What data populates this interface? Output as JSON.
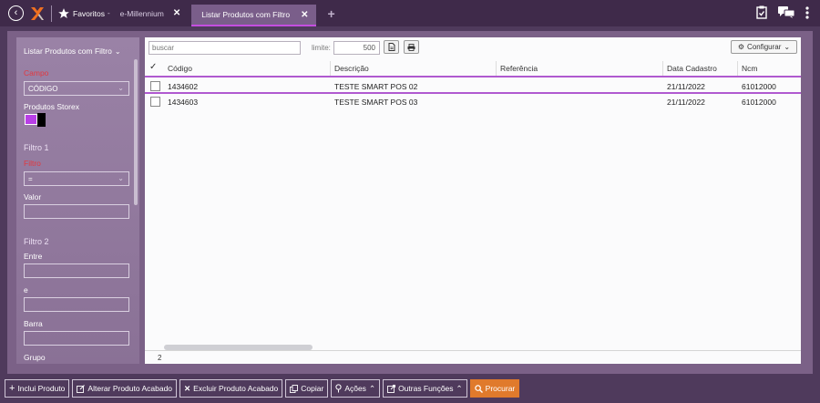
{
  "topbar": {
    "favorites_label": "Favoritos",
    "favorites_arrow": "-",
    "tabs": [
      {
        "label": "e-Millennium",
        "close": "✕"
      },
      {
        "label": "Listar Produtos com Filtro",
        "close": "✕",
        "active": true
      }
    ],
    "add_tab": "+",
    "icons": [
      "back-icon",
      "logo-icon",
      "star-icon",
      "clipboard-check-icon",
      "chat-icon",
      "kebab-menu-icon"
    ]
  },
  "sidebar": {
    "title": "Listar Produtos com Filtro",
    "title_chevron": "⌄",
    "campo_label": "Campo",
    "campo_value": "CÓDIGO",
    "produtos_storex_label": "Produtos Storex",
    "swatch_colors": [
      "#b83fe6",
      "#000000"
    ],
    "filtro1_heading": "Filtro 1",
    "filtro_label": "Filtro",
    "filtro_value": "=",
    "valor_label": "Valor",
    "valor_value": "",
    "filtro2_heading": "Filtro 2",
    "entre_label": "Entre",
    "e_label": "e",
    "barra_label": "Barra",
    "grupo_label": "Grupo"
  },
  "main": {
    "search_placeholder": "buscar",
    "limit_label": "limite:",
    "limit_value": "500",
    "configure_label": "Configurar",
    "columns": [
      "Código",
      "Descrição",
      "Referência",
      "Data Cadastro",
      "Ncm"
    ],
    "rows": [
      {
        "codigo": "1434602",
        "descricao": "TESTE SMART POS 02",
        "referencia": "",
        "data": "21/11/2022",
        "ncm": "61012000"
      },
      {
        "codigo": "1434603",
        "descricao": "TESTE SMART POS 03",
        "referencia": "",
        "data": "21/11/2022",
        "ncm": "61012000"
      }
    ],
    "count": "2"
  },
  "toolbar": {
    "buttons": [
      {
        "icon": "+",
        "label": "Inclui Produto"
      },
      {
        "icon": "edit-icon",
        "label": "Alterar Produto Acabado"
      },
      {
        "icon": "✕",
        "label": "Excluir Produto Acabado"
      },
      {
        "icon": "copy-icon",
        "label": "Copiar"
      },
      {
        "icon": "pin-icon",
        "label": "Ações"
      },
      {
        "icon": "external-icon",
        "label": "Outras Funções"
      },
      {
        "icon": "search-icon",
        "label": "Procurar"
      }
    ]
  },
  "colors": {
    "topbar_bg": "#3f2a4a",
    "accent": "#b05ad0",
    "primary_button": "#e07a2c"
  }
}
